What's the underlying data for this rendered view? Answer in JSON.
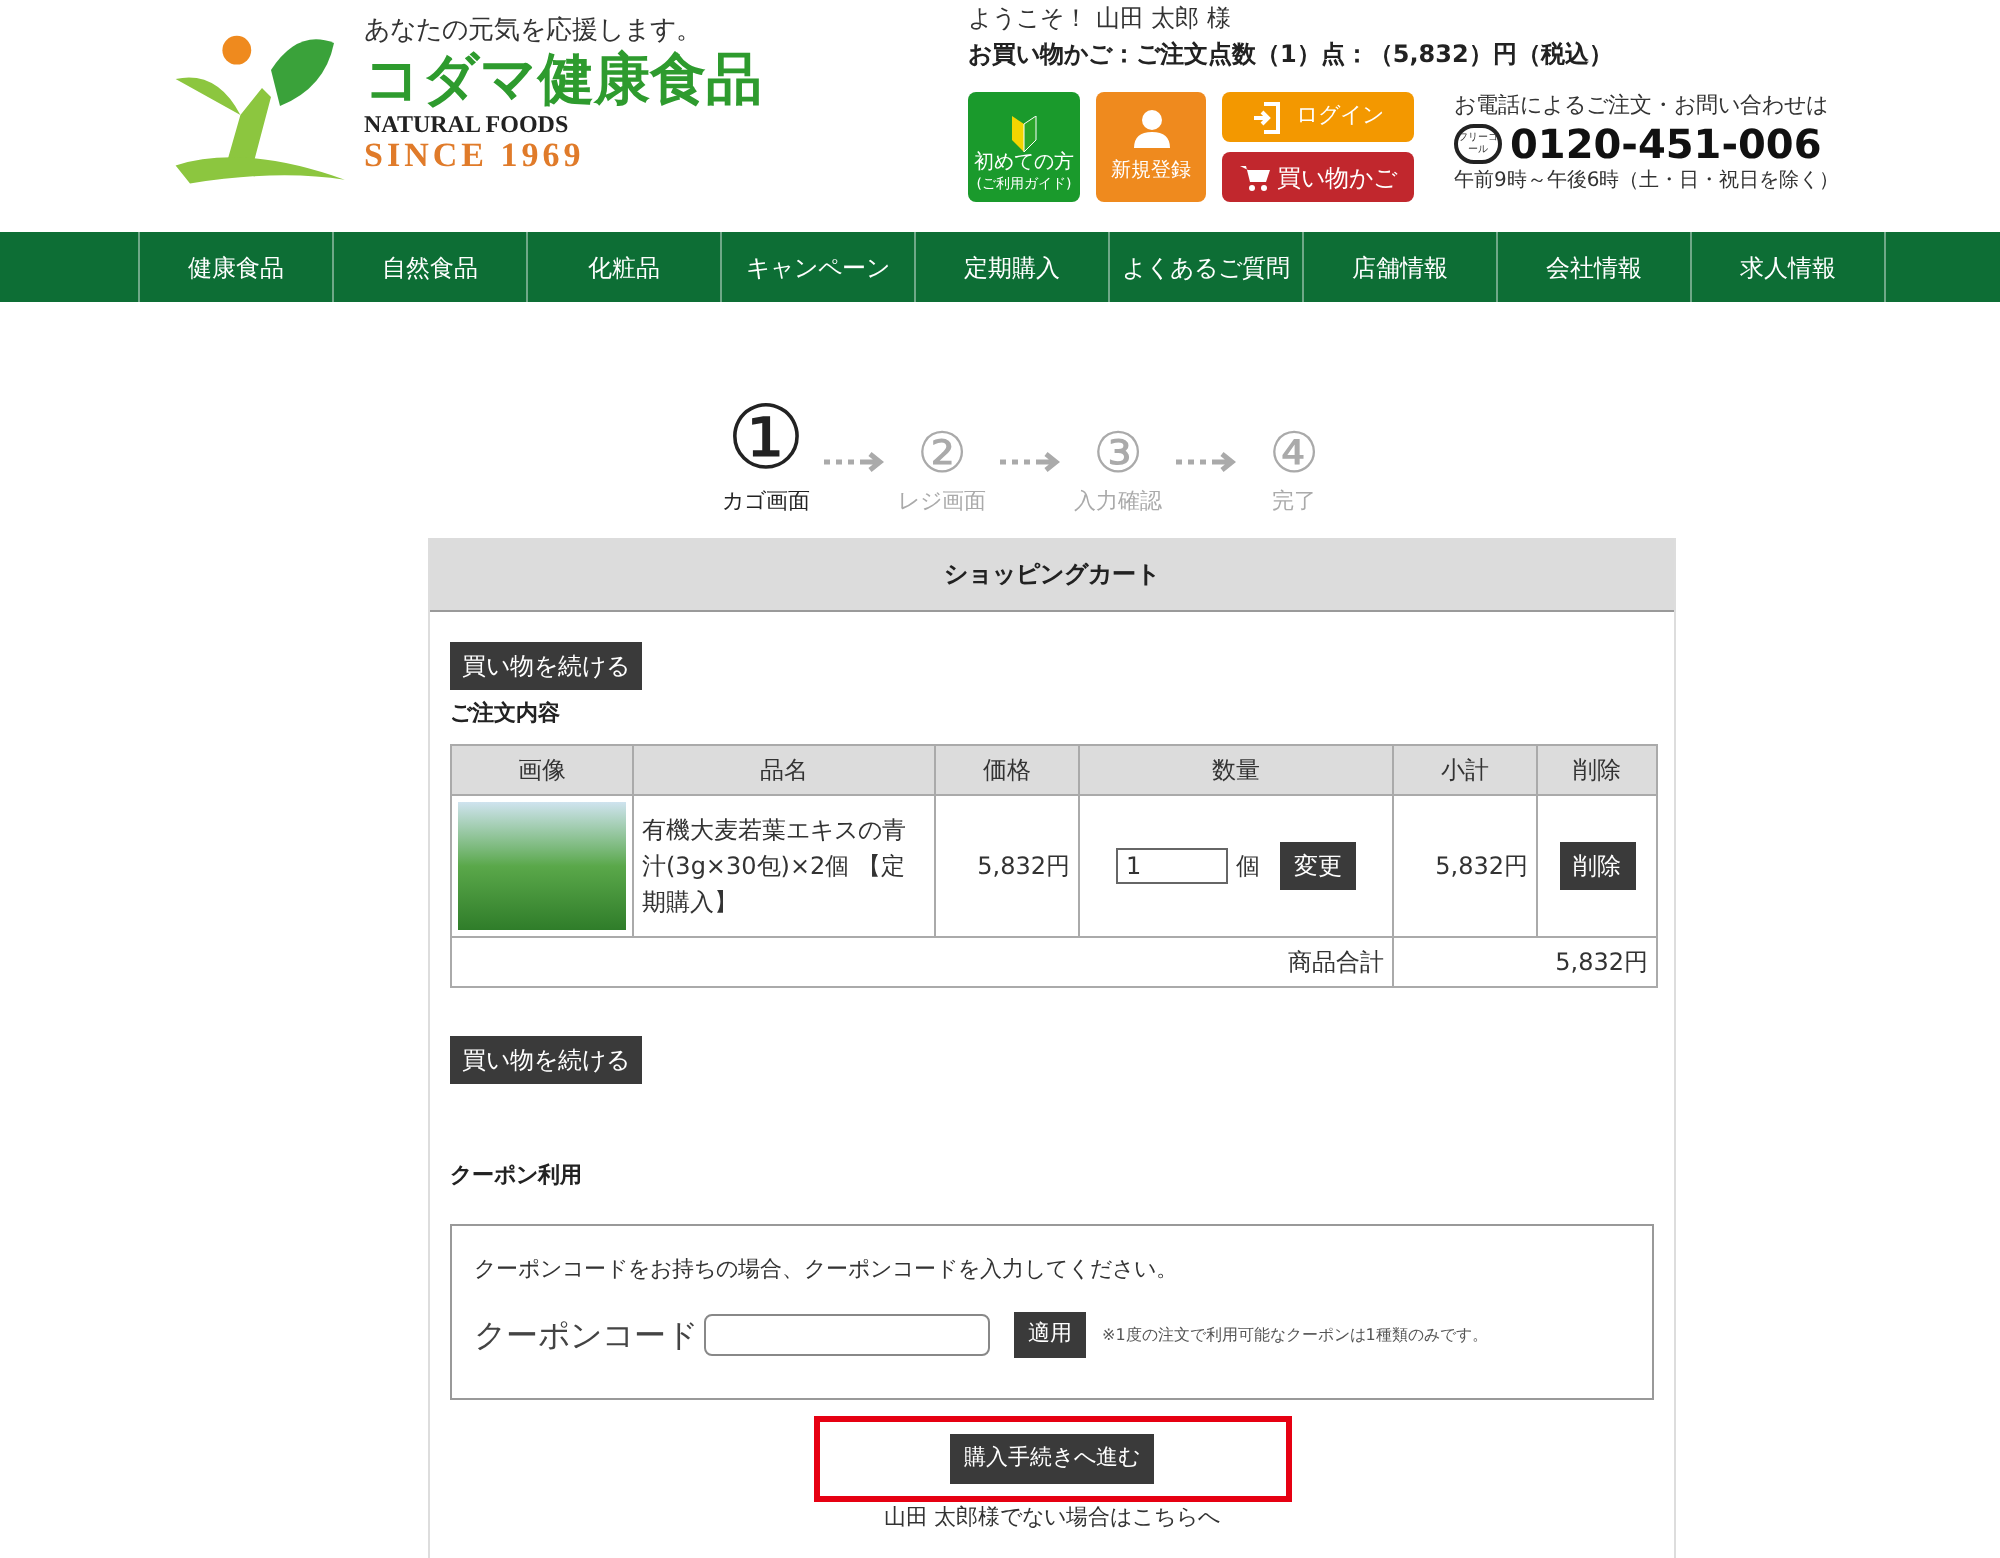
{
  "header": {
    "tagline": "あなたの元気を応援します。",
    "brand": "コダマ健康食品",
    "brand_sub": "NATURAL FOODS",
    "since": "SINCE 1969",
    "welcome": "ようこそ！ 山田 太郎 様",
    "cart_summary": "お買い物かご：ご注文点数（1）点：（5,832）円（税込）",
    "buttons": [
      {
        "kind": "guide",
        "label": "初めての方",
        "sub": "(ご利用ガイド)"
      },
      {
        "kind": "register",
        "label": "新規登録"
      },
      {
        "kind": "login",
        "label": "ログイン"
      },
      {
        "kind": "cart",
        "label": "買い物かご"
      }
    ],
    "phone": {
      "caption": "お電話によるご注文・お問い合わせは",
      "badge": "フリーコール",
      "number": "0120-451-006",
      "hours": "午前9時～午後6時（土・日・祝日を除く）"
    }
  },
  "nav": [
    "健康食品",
    "自然食品",
    "化粧品",
    "キャンペーン",
    "定期購入",
    "よくあるご質問",
    "店舗情報",
    "会社情報",
    "求人情報"
  ],
  "steps": [
    {
      "number": "①",
      "label": "カゴ画面",
      "selected": true
    },
    {
      "number": "②",
      "label": "レジ画面",
      "selected": false
    },
    {
      "number": "③",
      "label": "入力確認",
      "selected": false
    },
    {
      "number": "④",
      "label": "完了",
      "selected": false
    }
  ],
  "cart": {
    "title": "ショッピングカート",
    "continue_top": "買い物を続ける",
    "section": "ご注文内容",
    "columns": [
      "画像",
      "品名",
      "価格",
      "数量",
      "小計",
      "削除"
    ],
    "rows": [
      {
        "name": "有機大麦若葉エキスの青汁(3g×30包)×2個 【定期購入】",
        "price": "5,832円",
        "quantity": "1",
        "unit": "個",
        "change": "変更",
        "subtotal": "5,832円",
        "delete": "削除"
      }
    ],
    "total_label": "商品合計",
    "total": "5,832円",
    "continue_bottom": "買い物を続ける"
  },
  "coupon": {
    "title": "クーポン利用",
    "intro": "クーポンコードをお持ちの場合、クーポンコードを入力してください。",
    "label": "クーポンコード",
    "apply": "適用",
    "note": "※1度の注文で利用可能なクーポンは1種類のみです。"
  },
  "checkout": {
    "button": "購入手続きへ進む",
    "highlighted": true,
    "other_user": "山田 太郎様でない場合はこちらへ"
  }
}
